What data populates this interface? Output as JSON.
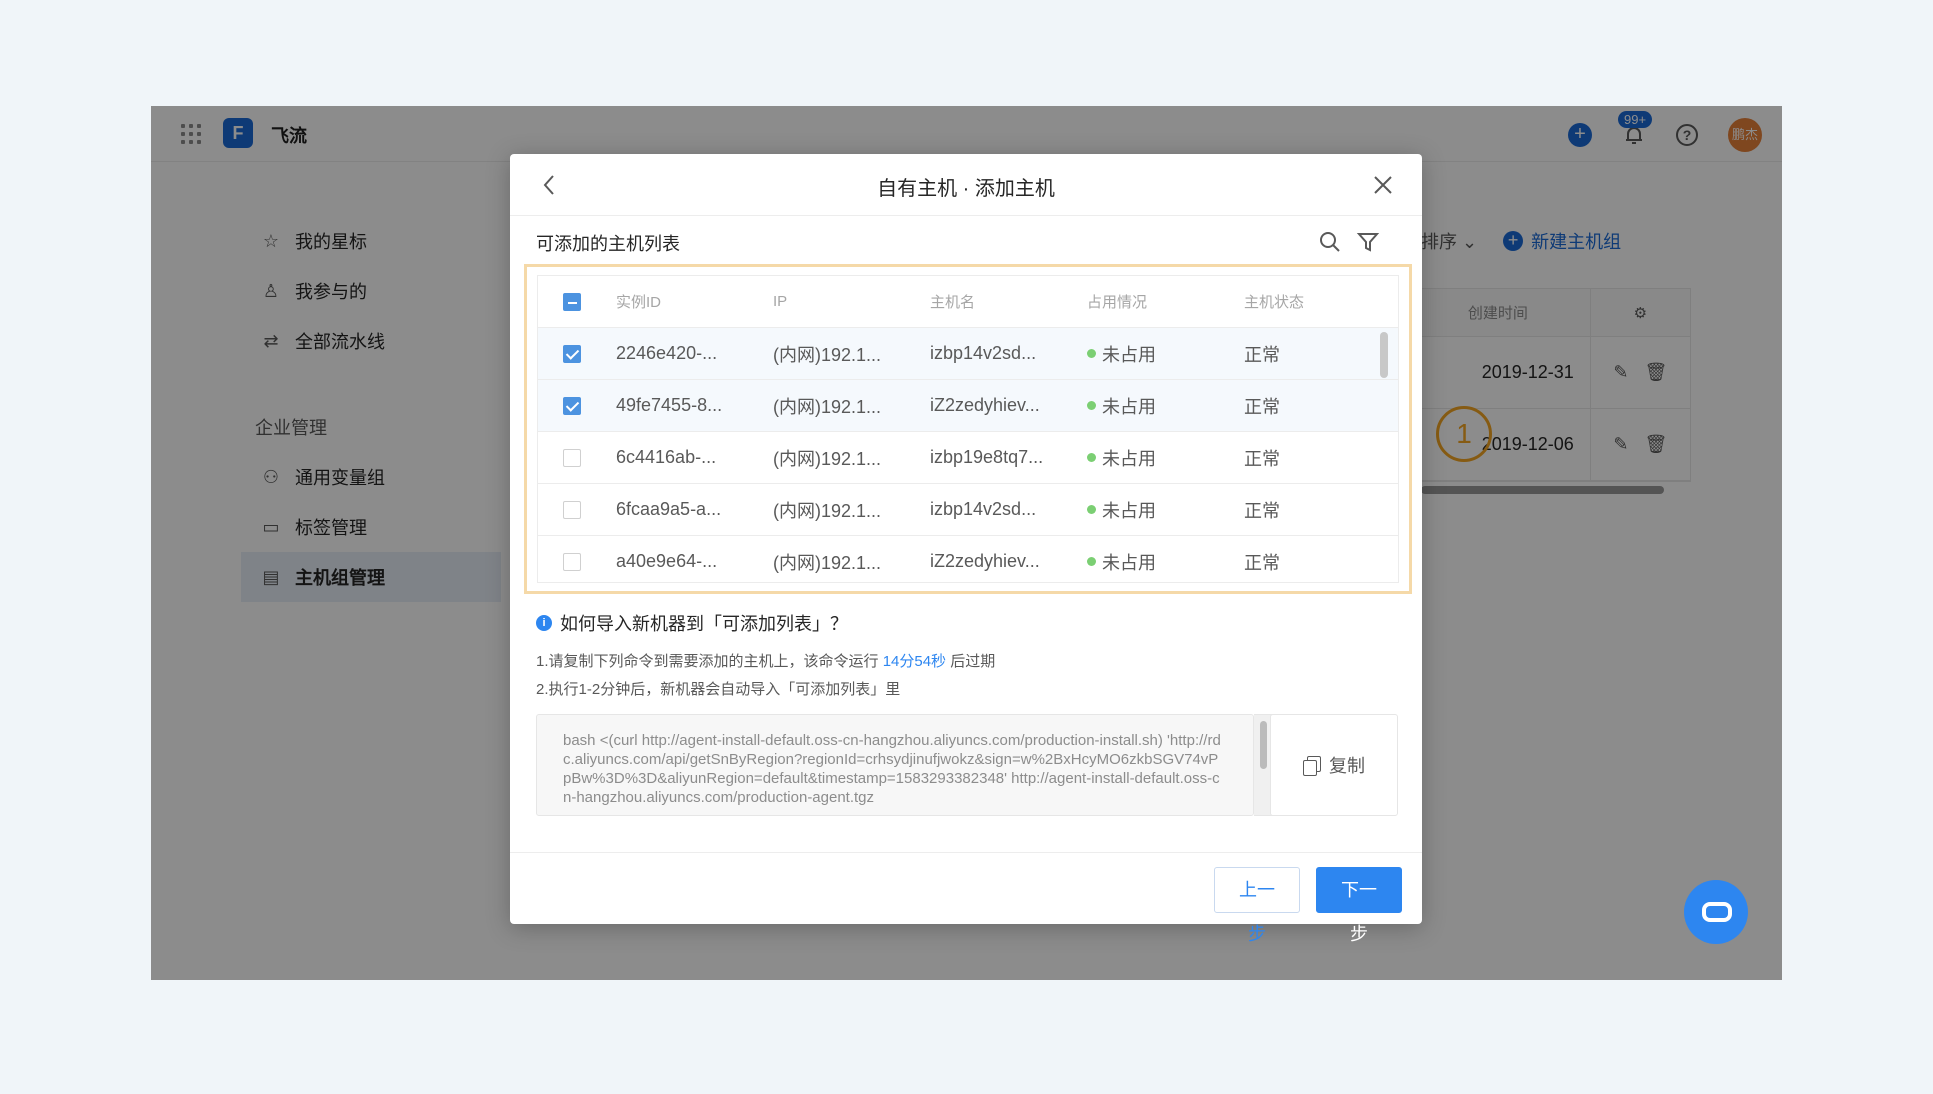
{
  "app": {
    "name": "飞流",
    "logo_letter": "F",
    "notification_count": "99+",
    "help_glyph": "?",
    "plus_glyph": "+",
    "avatar_text": "鹏杰"
  },
  "sidebar": {
    "items": [
      {
        "label": "我的星标",
        "icon": "star-icon",
        "glyph": "☆"
      },
      {
        "label": "我参与的",
        "icon": "user-icon",
        "glyph": "♙"
      },
      {
        "label": "全部流水线",
        "icon": "pipeline-icon",
        "glyph": "⇄"
      }
    ],
    "section": "企业管理",
    "admin_items": [
      {
        "label": "通用变量组",
        "icon": "variable-icon",
        "glyph": "⚇"
      },
      {
        "label": "标签管理",
        "icon": "tag-icon",
        "glyph": "▭"
      },
      {
        "label": "主机组管理",
        "icon": "host-group-icon",
        "glyph": "▤"
      }
    ]
  },
  "background": {
    "sort_label": "排序",
    "new_group_label": "新建主机组",
    "created_header": "创建时间",
    "rows": [
      {
        "created": "2019-12-31"
      },
      {
        "created": "2019-12-06"
      }
    ],
    "step_marker": "1"
  },
  "modal": {
    "title": "自有主机 · 添加主机",
    "list_title": "可添加的主机列表",
    "columns": [
      "实例ID",
      "IP",
      "主机名",
      "占用情况",
      "主机状态"
    ],
    "rows": [
      {
        "id": "2246e420-...",
        "ip": "(内网)192.1...",
        "host": "izbp14v2sd...",
        "usage": "未占用",
        "status": "正常",
        "checked": true
      },
      {
        "id": "49fe7455-8...",
        "ip": "(内网)192.1...",
        "host": "iZ2zedyhiev...",
        "usage": "未占用",
        "status": "正常",
        "checked": true
      },
      {
        "id": "6c4416ab-...",
        "ip": "(内网)192.1...",
        "host": "izbp19e8tq7...",
        "usage": "未占用",
        "status": "正常",
        "checked": false
      },
      {
        "id": "6fcaa9a5-a...",
        "ip": "(内网)192.1...",
        "host": "izbp14v2sd...",
        "usage": "未占用",
        "status": "正常",
        "checked": false
      },
      {
        "id": "a40e9e64-...",
        "ip": "(内网)192.1...",
        "host": "iZ2zedyhiev...",
        "usage": "未占用",
        "status": "正常",
        "checked": false
      }
    ],
    "howto_title": "如何导入新机器到「可添加列表」？",
    "info_glyph": "i",
    "step1_prefix": "1.请复制下列命令到需要添加的主机上，该命令运行 ",
    "step1_time": "14分54秒",
    "step1_suffix": " 后过期",
    "step2": "2.执行1-2分钟后，新机器会自动导入「可添加列表」里",
    "command": "bash <(curl http://agent-install-default.oss-cn-hangzhou.aliyuncs.com/production-install.sh) 'http://rdc.aliyuncs.com/api/getSnByRegion?regionId=crhsydjinufjwokz&sign=w%2BxHcyMO6zkbSGV74vPpBw%3D%3D&aliyunRegion=default&timestamp=1583293382348' http://agent-install-default.oss-cn-hangzhou.aliyuncs.com/production-agent.tgz",
    "copy_label": "复制",
    "prev_label": "上一步",
    "next_label": "下一步"
  },
  "colors": {
    "accent": "#2d86f0",
    "highlight_border": "#f5d9a8",
    "usage_dot": "#7bcf73",
    "marker": "#f5a623"
  }
}
